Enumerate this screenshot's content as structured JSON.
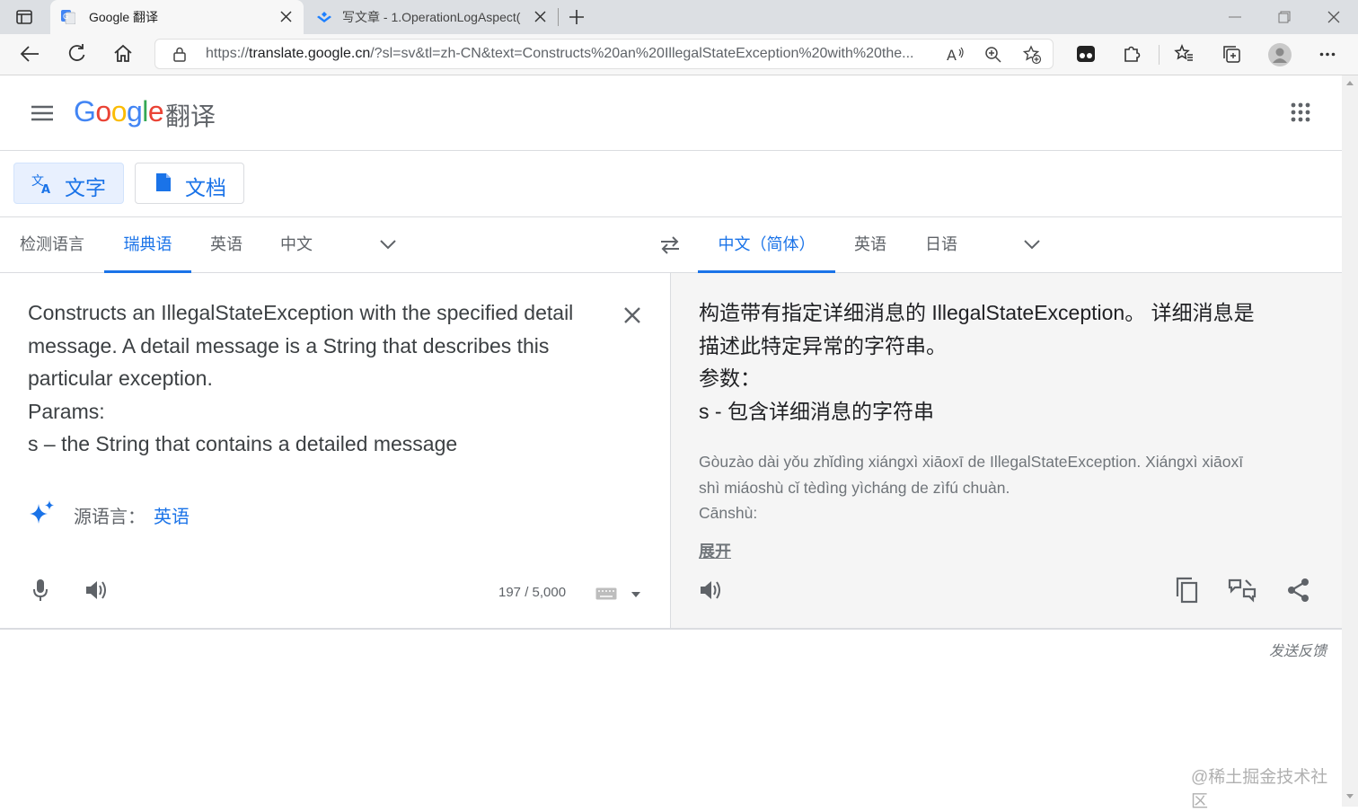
{
  "browser": {
    "tabs": [
      {
        "title": "Google 翻译",
        "active": true
      },
      {
        "title": "写文章 - 1.OperationLogAspect(",
        "active": false
      }
    ],
    "url_scheme": "https://",
    "url_host": "translate.google.cn",
    "url_rest": "/?sl=sv&tl=zh-CN&text=Constructs%20an%20IllegalStateException%20with%20the..."
  },
  "header": {
    "logo": "Google",
    "title": "翻译"
  },
  "modes": [
    {
      "label": "文字",
      "active": true
    },
    {
      "label": "文档",
      "active": false
    }
  ],
  "source_langs": [
    {
      "label": "检测语言",
      "active": false
    },
    {
      "label": "瑞典语",
      "active": true
    },
    {
      "label": "英语",
      "active": false
    },
    {
      "label": "中文",
      "active": false
    }
  ],
  "target_langs": [
    {
      "label": "中文（简体）",
      "active": true
    },
    {
      "label": "英语",
      "active": false
    },
    {
      "label": "日语",
      "active": false
    }
  ],
  "source": {
    "text": "Constructs an IllegalStateException with the specified detail\nmessage. A detail message is a String that describes this\nparticular exception.\nParams:\ns – the String that contains a detailed message",
    "detected_label": "源语言：",
    "detected_lang": "英语",
    "char_count": "197 / 5,000"
  },
  "target": {
    "text": "构造带有指定详细消息的 IllegalStateException。 详细消息是\n描述此特定异常的字符串。\n参数：\ns - 包含详细消息的字符串",
    "romanized": "Gòuzào dài yǒu zhǐdìng xiángxì xiāoxī de IllegalStateException. Xiángxì xiāoxī\nshì miáoshù cǐ tèdìng yìcháng de zìfú chuàn.\nCānshù:",
    "expand_label": "展开"
  },
  "footer": {
    "feedback": "发送反馈",
    "watermark": "@稀土掘金技术社区"
  },
  "colors": {
    "accent": "#1a73e8",
    "target_bg": "#f5f5f5"
  }
}
